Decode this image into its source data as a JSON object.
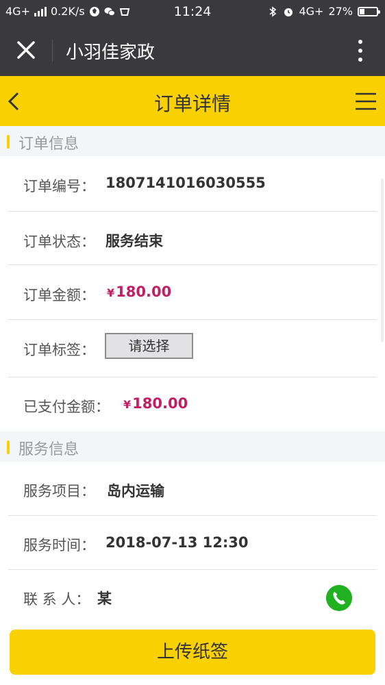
{
  "status_bar": {
    "network": "4G+",
    "speed": "0.2K/s",
    "time": "11:24",
    "net_right": "4G+",
    "battery": "27%",
    "battery_level": 0.27
  },
  "app_bar": {
    "title": "小羽佳家政",
    "icons": {
      "close": "close-icon",
      "more": "more-vertical-icon"
    }
  },
  "header": {
    "title": "订单详情",
    "icons": {
      "back": "chevron-left-icon",
      "menu": "hamburger-menu-icon"
    }
  },
  "order_info": {
    "section_title": "订单信息",
    "order_no_label": "订单编号：",
    "order_no": "1807141016030555",
    "status_label": "订单状态：",
    "status": "服务结束",
    "amount_label": "订单金额：",
    "amount_symbol": "¥",
    "amount": "180.00",
    "tag_label": "订单标签：",
    "tag_select": "请选择",
    "paid_label": "已支付金额：",
    "paid_symbol": "¥",
    "paid": "180.00"
  },
  "service_info": {
    "section_title": "服务信息",
    "item_label": "服务项目：",
    "item": "岛内运输",
    "time_label": "服务时间：",
    "time": "2018-07-13 12:30",
    "contact_label": "联 系 人：",
    "contact": "某",
    "phone_icon": "phone-icon"
  },
  "footer": {
    "upload_label": "上传纸签"
  },
  "colors": {
    "accent": "#f9d103",
    "dark_bar": "#3a3a3c",
    "money": "#c21e63",
    "phone": "#1fb11f"
  }
}
